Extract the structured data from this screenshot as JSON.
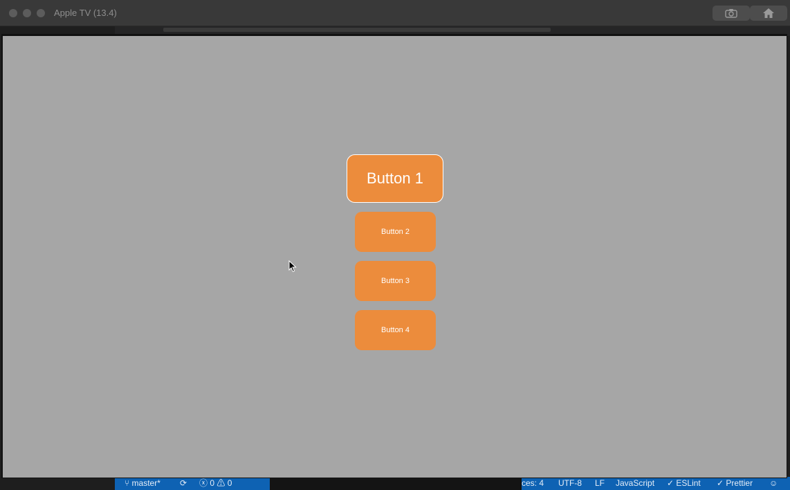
{
  "window": {
    "title": "Apple TV (13.4)",
    "toolbar": [
      "screenshot-icon",
      "home-icon"
    ]
  },
  "app": {
    "background_color": "#a6a6a6",
    "accent_color": "#ec8c3c",
    "buttons": [
      {
        "label": "Button 1",
        "focused": true
      },
      {
        "label": "Button 2",
        "focused": false
      },
      {
        "label": "Button 3",
        "focused": false
      },
      {
        "label": "Button 4",
        "focused": false
      }
    ]
  },
  "statusbar": {
    "branch": "master*",
    "errors": "0",
    "warnings": "0",
    "spaces": "ces: 4",
    "encoding": "UTF-8",
    "eol": "LF",
    "language": "JavaScript",
    "eslint": "ESLint",
    "prettier": "Prettier"
  }
}
